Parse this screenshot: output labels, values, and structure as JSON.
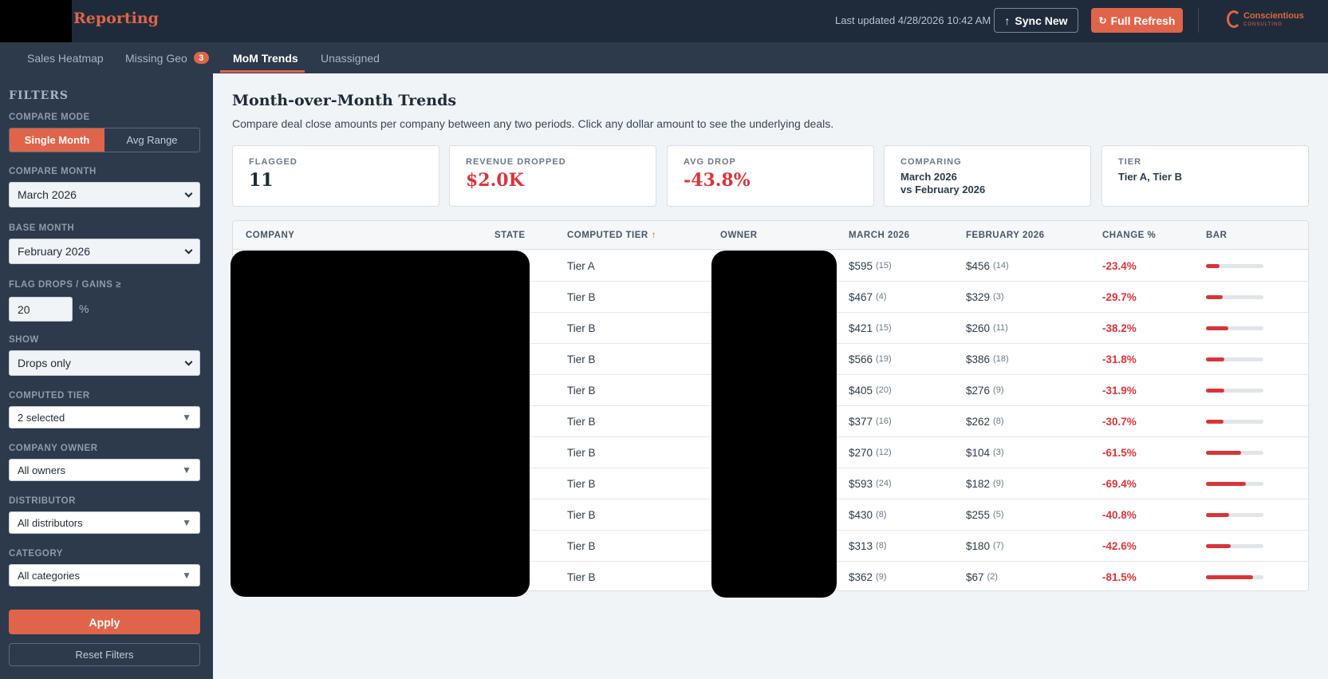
{
  "header": {
    "title": "Reporting",
    "last_updated": "Last updated 4/28/2026 10:42 AM",
    "sync_label": "Sync New",
    "refresh_label": "Full Refresh",
    "logo_name": "Conscientious",
    "logo_sub": "CONSULTING"
  },
  "tabs": [
    {
      "label": "Sales Heatmap"
    },
    {
      "label": "Missing Geo",
      "badge": "3"
    },
    {
      "label": "MoM Trends"
    },
    {
      "label": "Unassigned"
    }
  ],
  "sidebar": {
    "title": "FILTERS",
    "compare_mode_label": "COMPARE MODE",
    "mode_single": "Single Month",
    "mode_avg": "Avg Range",
    "compare_month_label": "COMPARE MONTH",
    "compare_month": "March 2026",
    "base_month_label": "BASE MONTH",
    "base_month": "February 2026",
    "flag_label": "FLAG DROPS / GAINS ≥",
    "flag_value": "20",
    "flag_unit": "%",
    "show_label": "SHOW",
    "show_value": "Drops only",
    "tier_label": "COMPUTED TIER",
    "tier_value": "2 selected",
    "owner_label": "COMPANY OWNER",
    "owner_value": "All owners",
    "distributor_label": "DISTRIBUTOR",
    "distributor_value": "All distributors",
    "category_label": "CATEGORY",
    "category_value": "All categories",
    "apply_label": "Apply",
    "reset_label": "Reset Filters"
  },
  "main": {
    "title": "Month-over-Month Trends",
    "subtitle": "Compare deal close amounts per company between any two periods. Click any dollar amount to see the underlying deals."
  },
  "cards": {
    "flagged_label": "FLAGGED",
    "flagged_value": "11",
    "revenue_label": "REVENUE DROPPED",
    "revenue_value": "$2.0K",
    "avg_label": "AVG DROP",
    "avg_value": "-43.8%",
    "comparing_label": "COMPARING",
    "comparing_line1": "March 2026",
    "comparing_line2": "vs February 2026",
    "tier_label": "TIER",
    "tier_value": "Tier A, Tier B"
  },
  "table": {
    "columns": [
      "COMPANY",
      "STATE",
      "COMPUTED TIER",
      "OWNER",
      "MARCH 2026",
      "FEBRUARY 2026",
      "CHANGE %",
      "BAR"
    ],
    "sort_arrow": "↑",
    "rows": [
      {
        "tier": "Tier A",
        "cur": "$595",
        "cur_n": "(15)",
        "base": "$456",
        "base_n": "(14)",
        "change": "-23.4%",
        "bar": 0.234
      },
      {
        "tier": "Tier B",
        "cur": "$467",
        "cur_n": "(4)",
        "base": "$329",
        "base_n": "(3)",
        "change": "-29.7%",
        "bar": 0.297
      },
      {
        "tier": "Tier B",
        "cur": "$421",
        "cur_n": "(15)",
        "base": "$260",
        "base_n": "(11)",
        "change": "-38.2%",
        "bar": 0.382
      },
      {
        "tier": "Tier B",
        "cur": "$566",
        "cur_n": "(19)",
        "base": "$386",
        "base_n": "(18)",
        "change": "-31.8%",
        "bar": 0.318
      },
      {
        "tier": "Tier B",
        "cur": "$405",
        "cur_n": "(20)",
        "base": "$276",
        "base_n": "(9)",
        "change": "-31.9%",
        "bar": 0.319
      },
      {
        "tier": "Tier B",
        "cur": "$377",
        "cur_n": "(16)",
        "base": "$262",
        "base_n": "(8)",
        "change": "-30.7%",
        "bar": 0.307
      },
      {
        "tier": "Tier B",
        "cur": "$270",
        "cur_n": "(12)",
        "base": "$104",
        "base_n": "(3)",
        "change": "-61.5%",
        "bar": 0.615
      },
      {
        "tier": "Tier B",
        "cur": "$593",
        "cur_n": "(24)",
        "base": "$182",
        "base_n": "(9)",
        "change": "-69.4%",
        "bar": 0.694
      },
      {
        "tier": "Tier B",
        "cur": "$430",
        "cur_n": "(8)",
        "base": "$255",
        "base_n": "(5)",
        "change": "-40.8%",
        "bar": 0.408
      },
      {
        "tier": "Tier B",
        "cur": "$313",
        "cur_n": "(8)",
        "base": "$180",
        "base_n": "(7)",
        "change": "-42.6%",
        "bar": 0.426
      },
      {
        "tier": "Tier B",
        "cur": "$362",
        "cur_n": "(9)",
        "base": "$67",
        "base_n": "(2)",
        "change": "-81.5%",
        "bar": 0.815
      }
    ]
  }
}
